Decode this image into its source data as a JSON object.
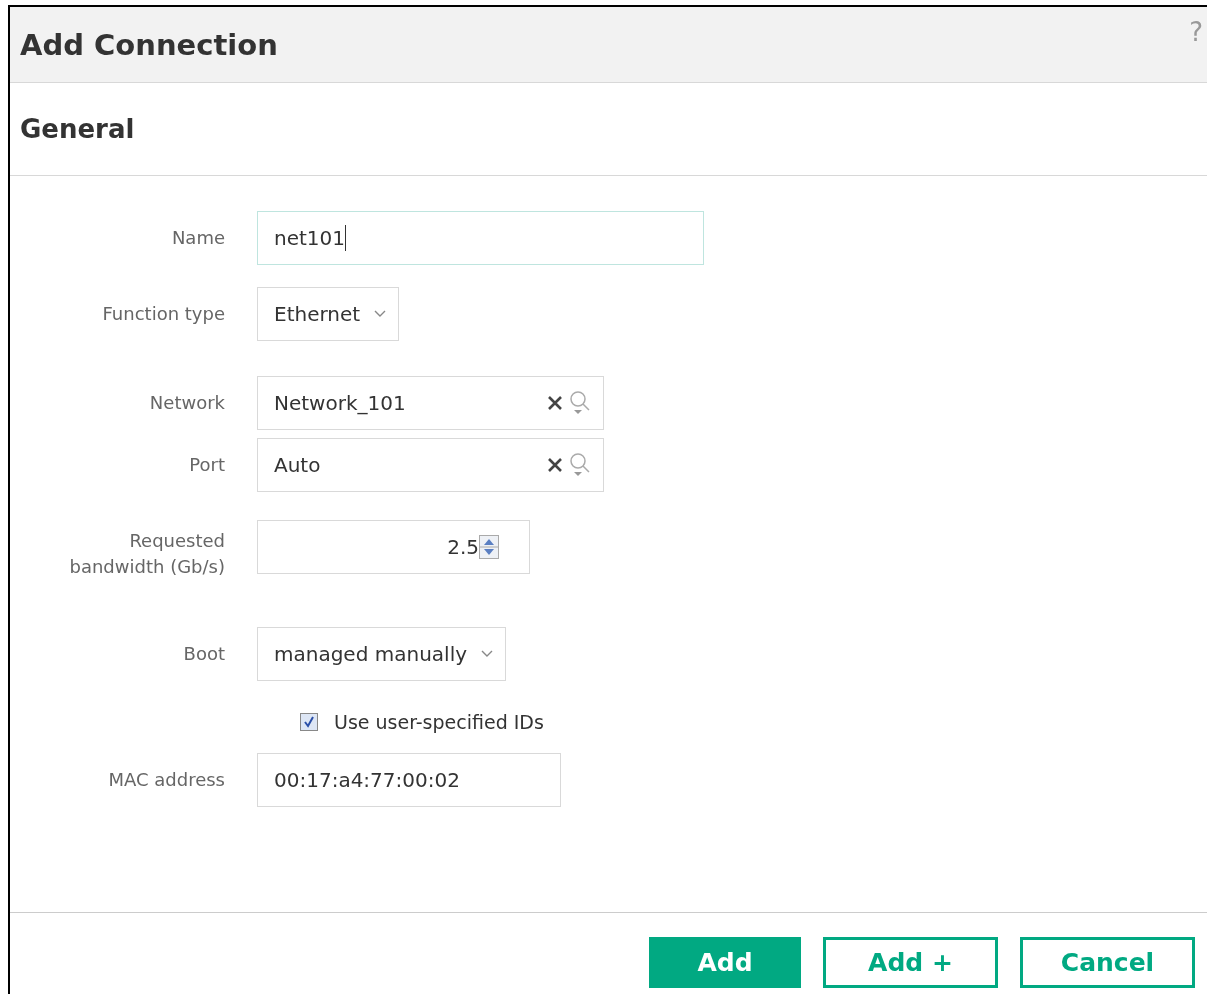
{
  "dialog": {
    "title": "Add Connection",
    "help": "?"
  },
  "section": {
    "title": "General"
  },
  "fields": [
    {
      "kind": "text",
      "label": "Name",
      "value": "net101",
      "focused": true
    },
    {
      "kind": "select",
      "label": "Function type",
      "value": "Ethernet"
    },
    {
      "kind": "lookup",
      "label": "Network",
      "value": "Network_101"
    },
    {
      "kind": "lookup",
      "label": "Port",
      "value": "Auto"
    },
    {
      "kind": "spinner",
      "label": "Requested bandwidth (Gb/s)",
      "value": "2.5"
    },
    {
      "kind": "select",
      "label": "Boot",
      "value": "managed manually"
    },
    {
      "kind": "checkbox",
      "label": "Use user-specified IDs",
      "checked": true
    },
    {
      "kind": "text",
      "label": "MAC address",
      "value": "00:17:a4:77:00:02",
      "focused": false
    }
  ],
  "buttons": [
    {
      "label": "Add",
      "primary": true
    },
    {
      "label": "Add +",
      "primary": false
    },
    {
      "label": "Cancel",
      "primary": false
    }
  ]
}
